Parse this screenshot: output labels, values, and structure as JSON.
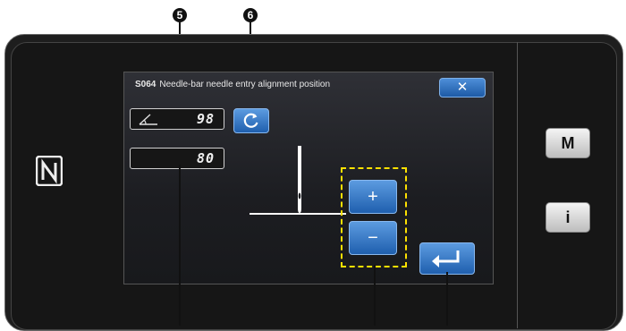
{
  "callouts": {
    "five": "5",
    "six": "6"
  },
  "side_buttons": {
    "m_label": "M",
    "info_label": "i"
  },
  "dialog": {
    "code": "S064",
    "title": "Needle-bar needle entry alignment position",
    "close_label": "✕"
  },
  "fields": {
    "angle_value": "98",
    "value2": "80"
  },
  "buttons": {
    "reset_icon": "reset-icon",
    "plus_label": "+",
    "minus_label": "−",
    "enter_icon": "enter-icon"
  },
  "colors": {
    "accent": "#1d5aa6",
    "highlight": "#ffe100",
    "background": "#1c1d21"
  }
}
